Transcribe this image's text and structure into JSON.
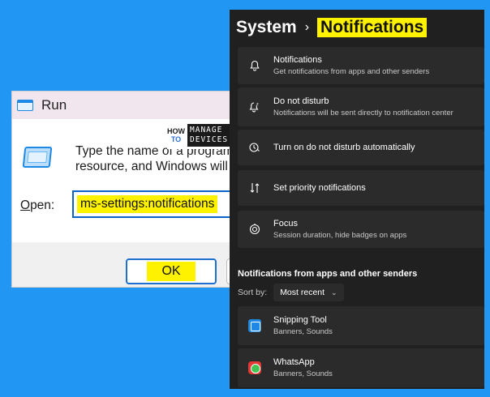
{
  "run_dialog": {
    "title": "Run",
    "description_line1": "Type the name of a program,",
    "description_line2": "resource, and Windows will",
    "open_label_underline": "O",
    "open_label_rest": "pen:",
    "open_value": "ms-settings:notifications",
    "ok_label": "OK"
  },
  "logo": {
    "how": "HOW",
    "to": "TO",
    "manage": "MANAGE",
    "devices": "DEVICES"
  },
  "settings": {
    "breadcrumb_parent": "System",
    "breadcrumb_separator": "›",
    "breadcrumb_current": "Notifications",
    "rows": [
      {
        "title": "Notifications",
        "subtitle": "Get notifications from apps and other senders",
        "icon": "bell-icon"
      },
      {
        "title": "Do not disturb",
        "subtitle": "Notifications will be sent directly to notification center",
        "icon": "bell-sleep-icon"
      },
      {
        "title": "Turn on do not disturb automatically",
        "subtitle": "",
        "icon": "clock-bell-icon"
      },
      {
        "title": "Set priority notifications",
        "subtitle": "",
        "icon": "priority-sort-icon"
      },
      {
        "title": "Focus",
        "subtitle": "Session duration, hide badges on apps",
        "icon": "focus-icon"
      }
    ],
    "section_heading": "Notifications from apps and other senders",
    "sort_label": "Sort by:",
    "sort_value": "Most recent",
    "apps": [
      {
        "name": "Snipping Tool",
        "detail": "Banners, Sounds",
        "icon": "snipping-tool-icon"
      },
      {
        "name": "WhatsApp",
        "detail": "Banners, Sounds",
        "icon": "whatsapp-icon"
      }
    ]
  },
  "colors": {
    "background": "#2196f3",
    "highlight": "#fff200",
    "settings_bg": "#202020",
    "card_bg": "#2b2b2b",
    "accent": "#0a63c6"
  }
}
